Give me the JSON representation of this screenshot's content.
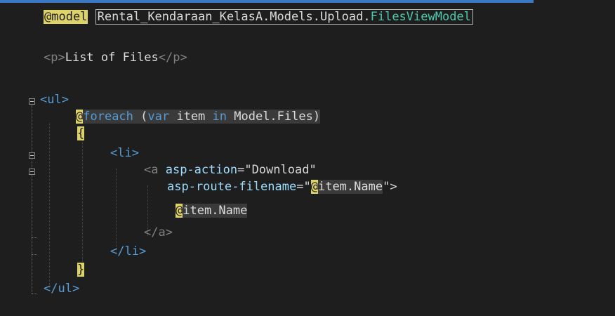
{
  "code": {
    "line1": {
      "directive": "@model",
      "namespace": "Rental_Kendaraan_KelasA.Models.Upload.",
      "type": "FilesViewModel"
    },
    "line2": {
      "open_tag": "<p>",
      "text": "List of Files",
      "close_tag": "</p>"
    },
    "line3": {
      "tag": "<ul>"
    },
    "line4": {
      "at": "@",
      "foreach": "foreach",
      "paren_open": " (",
      "var": "var",
      "item": " item ",
      "in": "in",
      "collection": " Model.Files)"
    },
    "line5": {
      "brace": "{"
    },
    "line6": {
      "tag": "<li>"
    },
    "line7": {
      "open": "<a ",
      "attr": "asp-action",
      "eq": "=",
      "value": "\"Download\""
    },
    "line8": {
      "attr": "asp-route-filename",
      "eq": "=\"",
      "at": "@",
      "expr": "item.Name",
      "close": "\">"
    },
    "line9": {
      "at": "@",
      "expr": "item.Name"
    },
    "line10": {
      "tag": "</a>"
    },
    "line11": {
      "tag": "</li>"
    },
    "line12": {
      "brace": "}"
    },
    "line13": {
      "tag": "</ul>"
    }
  },
  "colors": {
    "background": "#1e1e1e",
    "tag_bracket": "#808080",
    "tag_name": "#569cd6",
    "attribute": "#9cdcfe",
    "keyword": "#569cd6",
    "type": "#4ec9b0",
    "razor_highlight": "#ded36a"
  }
}
